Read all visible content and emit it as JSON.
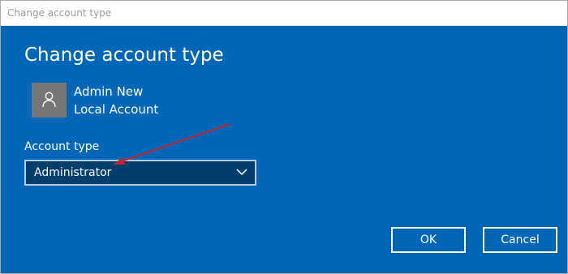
{
  "window": {
    "title": "Change account type"
  },
  "dialog": {
    "heading": "Change account type",
    "account": {
      "name": "Admin New",
      "kind": "Local Account",
      "avatar_icon": "user-icon"
    },
    "account_type": {
      "label": "Account type",
      "selected": "Administrator",
      "chevron_icon": "chevron-down-icon"
    },
    "buttons": {
      "ok": "OK",
      "cancel": "Cancel"
    }
  },
  "colors": {
    "dialog_background": "#0067b8",
    "select_background": "#003e6e",
    "avatar_background": "#767676",
    "annotation_arrow": "#c1272d"
  }
}
